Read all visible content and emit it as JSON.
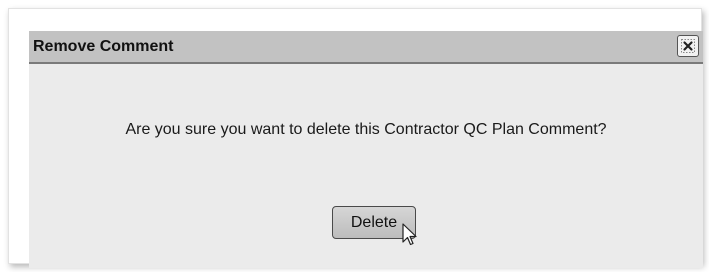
{
  "dialog": {
    "title": "Remove Comment",
    "close_icon": "close-icon",
    "message": "Are you sure you want to delete this Contractor QC Plan Comment?",
    "delete_label": "Delete"
  },
  "cursor_icon": "mouse-pointer-icon",
  "colors": {
    "titlebar": "#c2c2c2",
    "dialog_body": "#ebebeb",
    "button": "#c9c9c9"
  }
}
